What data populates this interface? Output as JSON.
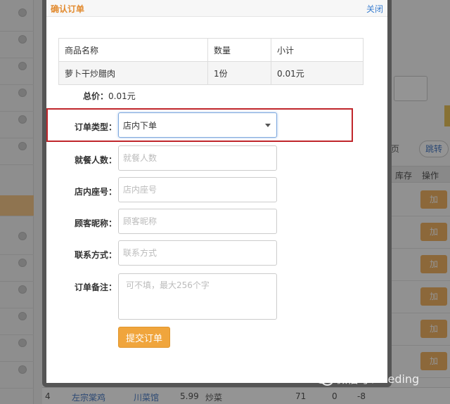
{
  "modal": {
    "title": "确认订单",
    "close_label": "关闭",
    "table": {
      "headers": [
        "商品名称",
        "数量",
        "小计"
      ],
      "rows": [
        [
          "萝卜干炒腊肉",
          "1份",
          "0.01元"
        ]
      ]
    },
    "total_label": "总价：",
    "total_value": "0.01元",
    "order_type": {
      "label": "订单类型：",
      "selected": "店内下单"
    },
    "diners": {
      "label": "就餐人数：",
      "placeholder": "就餐人数"
    },
    "seat": {
      "label": "店内座号：",
      "placeholder": "店内座号"
    },
    "nickname": {
      "label": "顾客昵称：",
      "placeholder": "顾客昵称"
    },
    "contact": {
      "label": "联系方式：",
      "placeholder": "联系方式"
    },
    "remark": {
      "label": "订单备注：",
      "placeholder": "可不填，最大256个字"
    },
    "submit_label": "提交订单"
  },
  "background": {
    "pager_label": "页",
    "jump_label": "跳转",
    "col_stock": "库存",
    "col_action": "操作",
    "add_label": "加",
    "bottom_row": {
      "index": "4",
      "name": "左宗棠鸡",
      "shop": "川菜馆",
      "price": "5.99",
      "method": "炒菜",
      "qty": "71",
      "stock1": "0",
      "stock2": "-8"
    }
  },
  "watermark": "微信号：veding",
  "colors": {
    "accent": "#f0a53c",
    "title": "#e28a2e",
    "highlight": "#c0262b",
    "link": "#3b7fd0"
  }
}
